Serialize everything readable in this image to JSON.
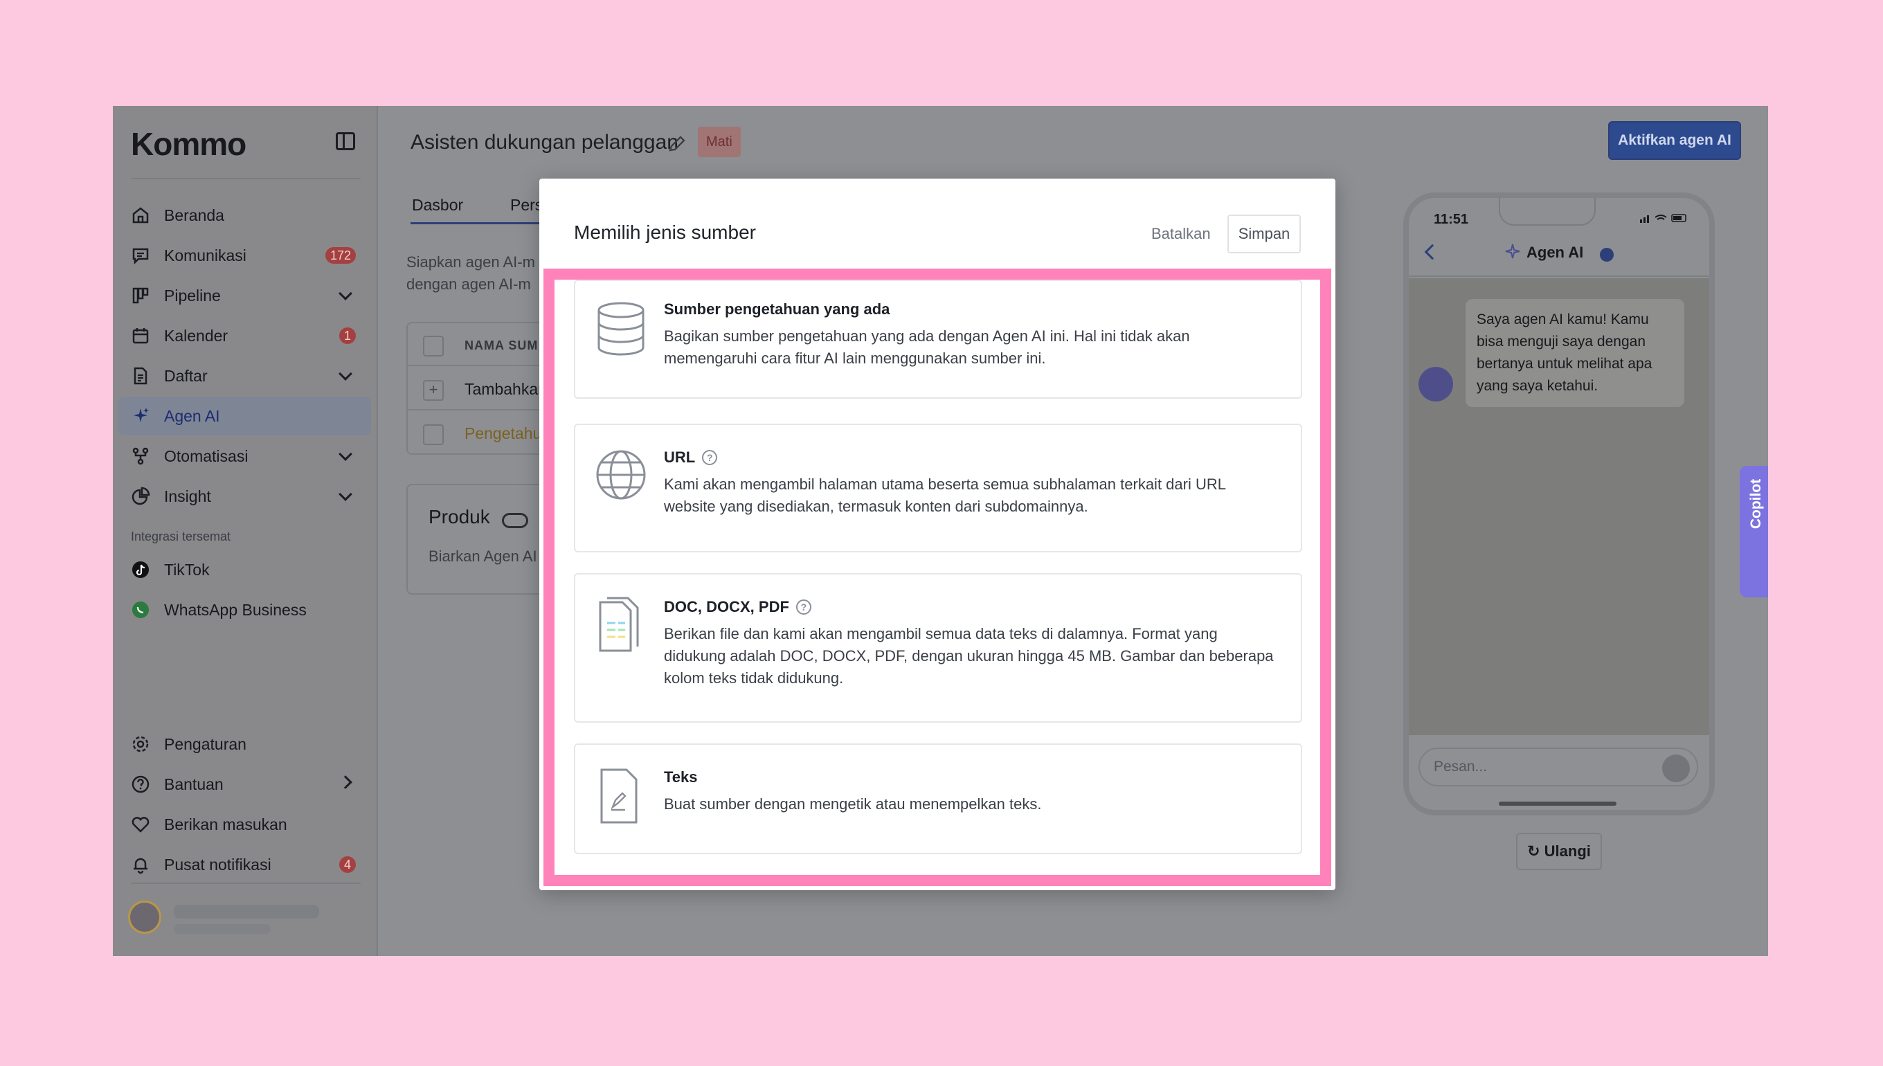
{
  "sidebar": {
    "logo": "Kommo",
    "items": [
      {
        "label": "Beranda"
      },
      {
        "label": "Komunikasi",
        "badge": "172"
      },
      {
        "label": "Pipeline"
      },
      {
        "label": "Kalender",
        "badge": "1"
      },
      {
        "label": "Daftar"
      },
      {
        "label": "Agen AI"
      },
      {
        "label": "Otomatisasi"
      },
      {
        "label": "Insight"
      }
    ],
    "section_label": "Integrasi tersemat",
    "integrations": [
      {
        "label": "TikTok"
      },
      {
        "label": "WhatsApp Business"
      }
    ],
    "bottom_items": [
      {
        "label": "Pengaturan"
      },
      {
        "label": "Bantuan"
      },
      {
        "label": "Berikan masukan"
      },
      {
        "label": "Pusat notifikasi",
        "badge": "4"
      }
    ]
  },
  "main": {
    "title": "Asisten dukungan pelanggan",
    "status": "Mati",
    "activate_button": "Aktifkan agen AI",
    "tabs": [
      {
        "label": "Dasbor"
      },
      {
        "label": "Pers"
      }
    ],
    "intro_line1": "Siapkan agen AI-m",
    "intro_line2": "dengan agen AI-m",
    "table": {
      "header": "NAMA SUM",
      "rows": [
        {
          "label": "Tambahkan"
        },
        {
          "label": "Pengetahu"
        }
      ]
    },
    "produk": {
      "title": "Produk",
      "subtitle": "Biarkan Agen AI"
    }
  },
  "phone": {
    "time": "11:51",
    "agent_name": "Agen AI",
    "message": "Saya agen AI kamu! Kamu bisa menguji saya dengan bertanya untuk melihat apa yang saya ketahui.",
    "input_placeholder": "Pesan...",
    "retry_button": "Ulangi"
  },
  "copilot": {
    "label": "Copilot"
  },
  "modal": {
    "title": "Memilih jenis sumber",
    "cancel": "Batalkan",
    "save": "Simpan",
    "highlight_color": "#ff82ba",
    "options": [
      {
        "title": "Sumber pengetahuan yang ada",
        "icon": "database-icon",
        "desc_lines": [
          "Bagikan sumber pengetahuan yang ada dengan Agen AI ini. Hal ini tidak akan",
          "memengaruhi cara fitur AI lain menggunakan sumber ini."
        ]
      },
      {
        "title": "URL",
        "icon": "globe-icon",
        "desc_lines": [
          "Kami akan mengambil halaman utama beserta semua subhalaman terkait dari URL",
          "website yang disediakan, termasuk konten dari subdomainnya."
        ]
      },
      {
        "title": "DOC, DOCX, PDF",
        "icon": "documents-icon",
        "desc_lines": [
          "Berikan file dan kami akan mengambil semua data teks di dalamnya. Format yang",
          "didukung adalah DOC, DOCX, PDF, dengan ukuran hingga 45 MB. Gambar dan beberapa",
          "kolom teks tidak didukung."
        ]
      },
      {
        "title": "Teks",
        "icon": "text-file-icon",
        "desc_lines": [
          "Buat sumber dengan mengetik atau menempelkan teks."
        ]
      }
    ]
  }
}
